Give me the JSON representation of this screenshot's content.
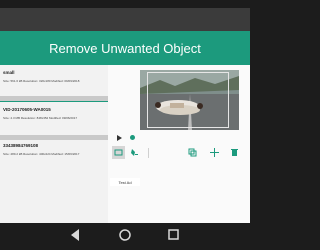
{
  "app": {
    "title": "Remove Unwanted Object"
  },
  "files": [
    {
      "name": "small",
      "meta": "Size: 561.6 kB  Resolution: 320x180  Modified: 09/09/2018"
    },
    {
      "name": "VID-20170605-WA0015",
      "meta": "Size: 2.3 MB  Resolution: 848x352  Modified: 09/06/2017"
    },
    {
      "name": "33438984769108",
      "meta": "Size: 289.2 kB  Resolution: 400x224  Modified: 15/06/2017"
    }
  ],
  "player": {
    "play_icon": "play-icon",
    "dot_color": "#1c9a7d"
  },
  "toolbar": {
    "tools": [
      {
        "icon": "rectangle-select-icon",
        "selected": true
      },
      {
        "icon": "brush-erase-icon"
      },
      {
        "icon": "duplicate-icon"
      },
      {
        "icon": "plus-icon"
      },
      {
        "icon": "trash-icon"
      }
    ]
  },
  "ad": {
    "label": "Test Ad"
  },
  "colors": {
    "accent": "#1c9a7d",
    "statusbar": "#3b3b3b",
    "bezel": "#1c1c1c"
  }
}
